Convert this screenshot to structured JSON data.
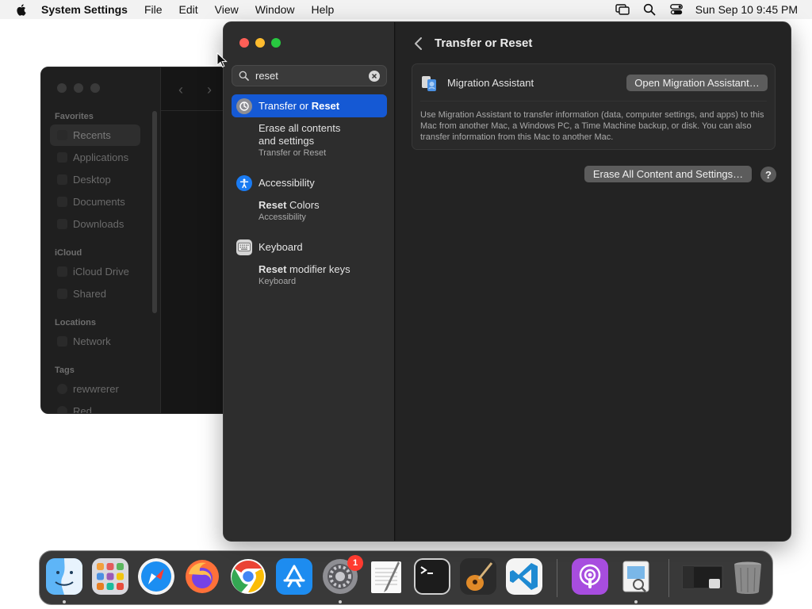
{
  "menubar": {
    "app_name": "System Settings",
    "items": [
      "File",
      "Edit",
      "View",
      "Window",
      "Help"
    ],
    "clock": "Sun Sep 10  9:45 PM"
  },
  "finder": {
    "sections": {
      "favorites": "Favorites",
      "icloud": "iCloud",
      "locations": "Locations",
      "tags": "Tags"
    },
    "favorites": [
      "Recents",
      "Applications",
      "Desktop",
      "Documents",
      "Downloads"
    ],
    "icloud": [
      "iCloud Drive",
      "Shared"
    ],
    "locations": [
      "Network"
    ],
    "tags": [
      "rewwrerer",
      "Red"
    ]
  },
  "settings": {
    "search": {
      "value": "reset"
    },
    "results": [
      {
        "title_plain": "Transfer or ",
        "title_match": "Reset",
        "icon": "transfer-reset-icon",
        "sub": {
          "line1": "Erase all contents",
          "line2": "and settings",
          "category": "Transfer or Reset"
        }
      },
      {
        "title": "Accessibility",
        "icon": "accessibility-icon",
        "sub": {
          "match": "Reset",
          "rest": " Colors",
          "category": "Accessibility"
        }
      },
      {
        "title": "Keyboard",
        "icon": "keyboard-icon",
        "sub": {
          "match": "Reset",
          "rest": " modifier keys",
          "category": "Keyboard"
        }
      }
    ],
    "pane": {
      "title": "Transfer or Reset",
      "migration_label": "Migration Assistant",
      "open_button": "Open Migration Assistant…",
      "description": "Use Migration Assistant to transfer information (data, computer settings, and apps) to this Mac from another Mac, a Windows PC, a Time Machine backup, or disk. You can also transfer information from this Mac to another Mac.",
      "erase_button": "Erase All Content and Settings…",
      "help": "?"
    }
  },
  "dock": {
    "apps": [
      "Finder",
      "Launchpad",
      "Safari",
      "Firefox",
      "Chrome",
      "App Store",
      "System Settings",
      "TextEdit",
      "Terminal",
      "GarageBand",
      "Visual Studio Code",
      "Podcasts",
      "Preview"
    ],
    "system_settings_badge": "1"
  },
  "colors": {
    "accent": "#1559d4",
    "badge": "#ff3b30",
    "traffic_red": "#ff5f57",
    "traffic_yellow": "#febc2e",
    "traffic_green": "#28c840"
  }
}
